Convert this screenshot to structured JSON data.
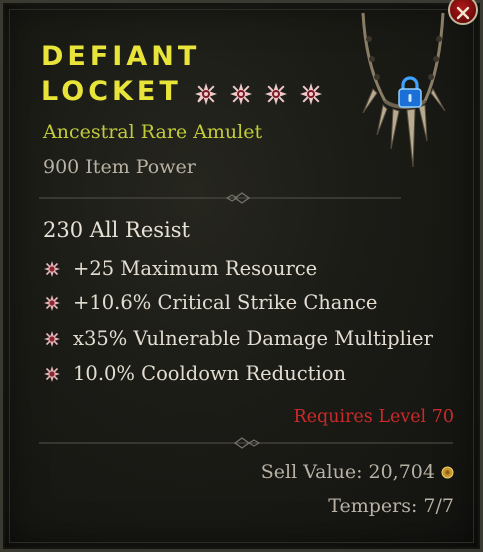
{
  "item": {
    "name_line1": "DEFIANT",
    "name_line2": "LOCKET",
    "type": "Ancestral Rare Amulet",
    "power": "900 Item Power",
    "implicit": "230 All Resist",
    "affixes": [
      "+25 Maximum Resource",
      "+10.6% Critical Strike Chance",
      "x35% Vulnerable Damage Multiplier",
      "10.0% Cooldown Reduction"
    ],
    "requires": "Requires Level 70",
    "sell_value": "Sell Value: 20,704",
    "tempers": "Tempers: 7/7",
    "gem_icons": [
      "greater-affix-icon",
      "greater-affix-icon",
      "greater-affix-icon",
      "greater-affix-icon"
    ]
  },
  "colors": {
    "name": "#e8e43a",
    "type": "#c2cc3b",
    "requires": "#cc2a2a",
    "affix_bullet": "#e6b3b8",
    "lock": "#3fa2ff"
  },
  "icons": {
    "close": "close-icon",
    "lock": "lock-icon",
    "gold": "gold-coin-icon",
    "amulet": "amulet-icon"
  }
}
